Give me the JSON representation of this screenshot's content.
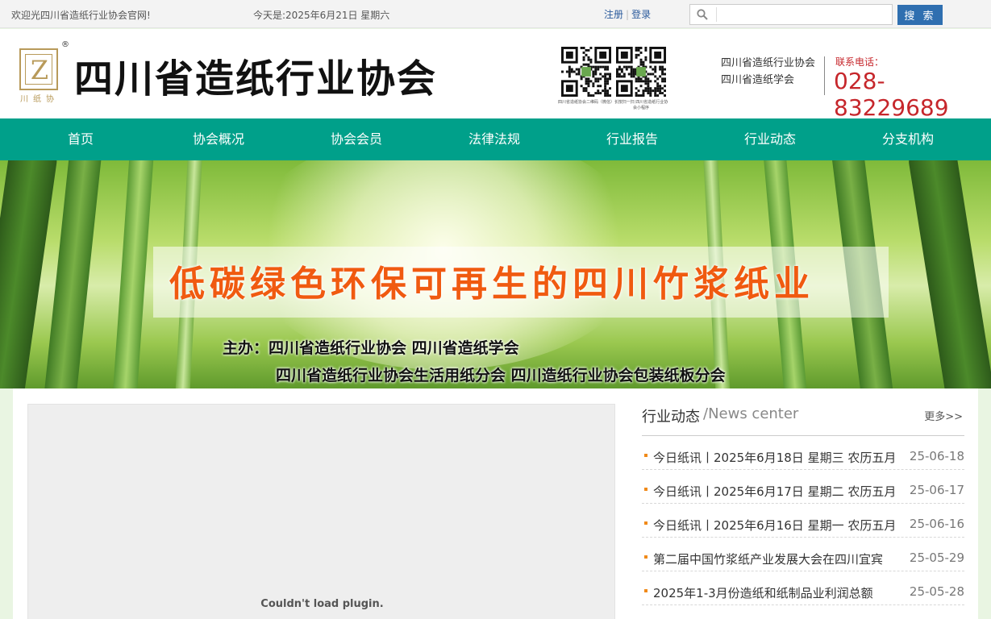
{
  "topbar": {
    "welcome": "欢迎光四川省造纸行业协会官网!",
    "date": "今天是:2025年6月21日 星期六",
    "register": "注册",
    "login": "登录",
    "search_placeholder": "",
    "search_button": "搜 索"
  },
  "header": {
    "logo_letter": "Z",
    "logo_sub": "川纸协",
    "logo_reg": "®",
    "site_title": "四川省造纸行业协会",
    "qr1_caption": "四川省造纸协会二维码（微信）",
    "qr2_caption": "长按扫一扫  四川省造纸行业协会小程序",
    "assoc_line1": "四川省造纸行业协会",
    "assoc_line2": "四川省造纸学会",
    "phone_label": "联系电话：",
    "phone": "028-83229689"
  },
  "nav": {
    "items": [
      "首页",
      "协会概况",
      "协会会员",
      "法律法规",
      "行业报告",
      "行业动态",
      "分支机构"
    ]
  },
  "banner": {
    "slogan": "低碳绿色环保可再生的四川竹浆纸业",
    "sponsor_line1": "主办：四川省造纸行业协会 四川省造纸学会",
    "sponsor_line2": "四川省造纸行业协会生活用纸分会 四川造纸行业协会包装纸板分会"
  },
  "plugin": {
    "message": "Couldn't load plugin."
  },
  "news": {
    "title_cn": "行业动态",
    "title_en": "/News center",
    "more": "更多>>",
    "items": [
      {
        "title": "今日纸讯丨2025年6月18日 星期三 农历五月",
        "date": "25-06-18"
      },
      {
        "title": "今日纸讯丨2025年6月17日 星期二 农历五月",
        "date": "25-06-17"
      },
      {
        "title": "今日纸讯丨2025年6月16日 星期一 农历五月",
        "date": "25-06-16"
      },
      {
        "title": "第二届中国竹浆纸产业发展大会在四川宜宾",
        "date": "25-05-29"
      },
      {
        "title": "2025年1-3月份造纸和纸制品业利润总额",
        "date": "25-05-28"
      }
    ]
  },
  "colors": {
    "nav_bg": "#00a08a",
    "phone": "#c6262b",
    "search_button": "#2f6fb0",
    "slogan": "#f05a10",
    "news_bullet": "#f08a1a"
  }
}
